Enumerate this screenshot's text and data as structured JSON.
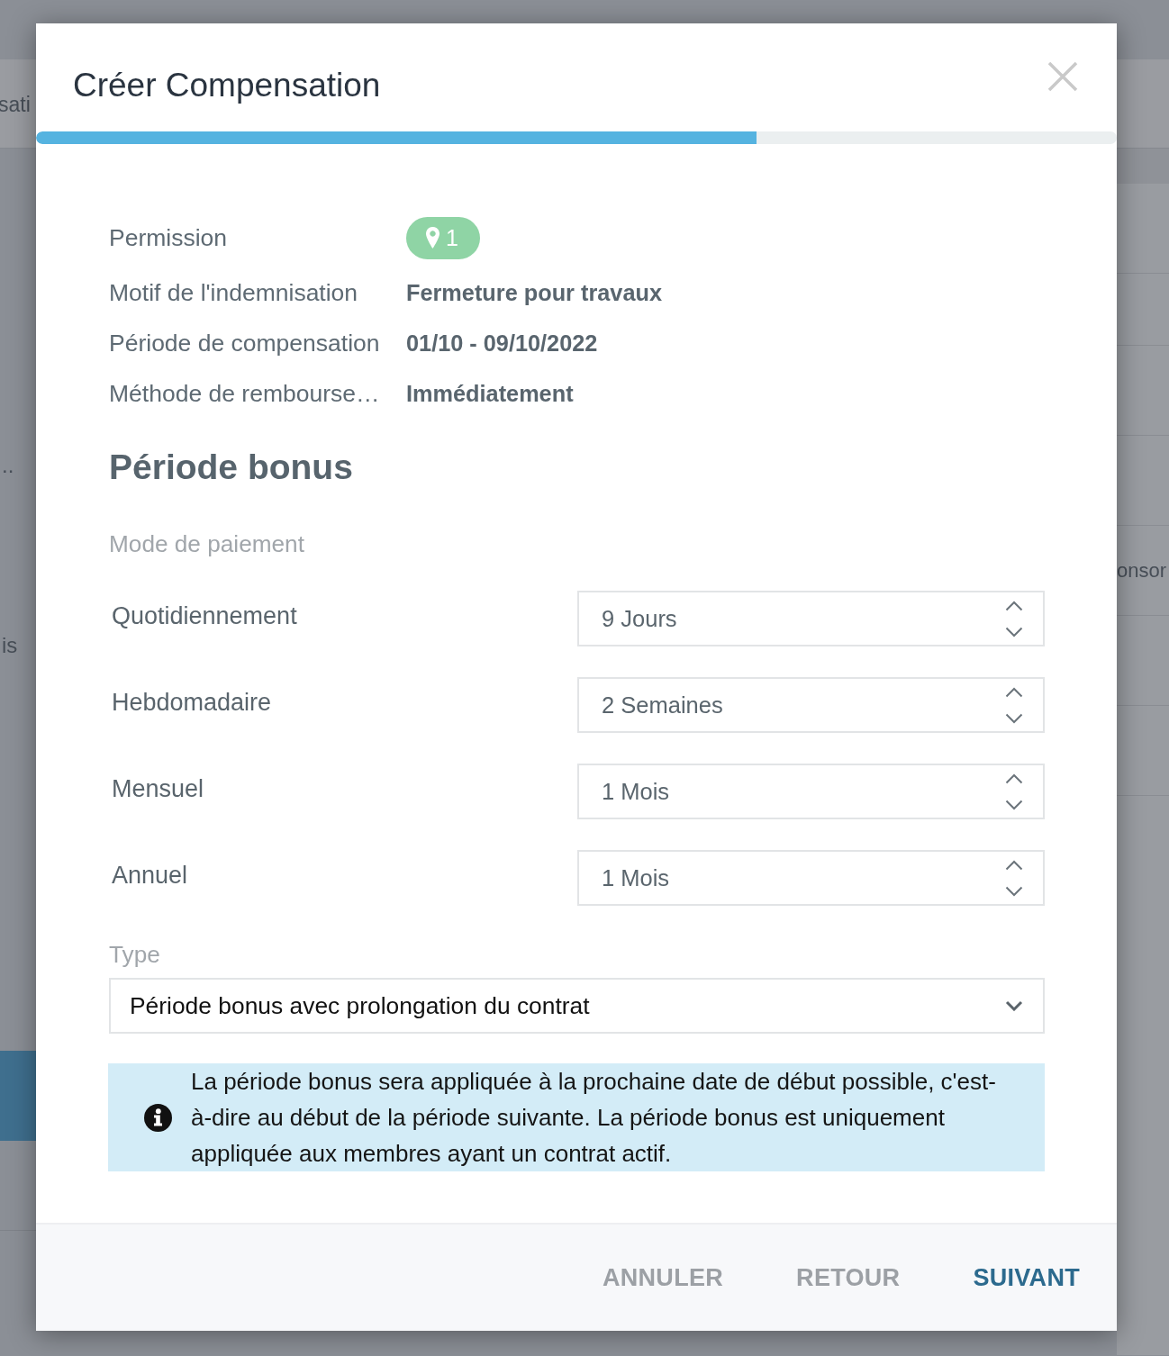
{
  "background": {
    "header_text": "sati",
    "left_rows": [
      {
        "selected": false
      },
      {
        "selected": false
      },
      {
        "selected": false
      },
      {
        "text": "..",
        "selected": false
      },
      {
        "selected": false
      },
      {
        "text": "is",
        "selected": false
      },
      {
        "selected": false
      },
      {
        "selected": false
      },
      {
        "selected": false
      },
      {
        "selected": false
      },
      {
        "selected": true
      },
      {
        "selected": false
      }
    ],
    "right_rows": [
      {
        "selected": false
      },
      {
        "selected": false
      },
      {
        "selected": false
      },
      {
        "selected": false
      },
      {
        "text": "onsor",
        "selected": false
      },
      {
        "selected": false
      },
      {
        "selected": false
      }
    ]
  },
  "dialog": {
    "title": "Créer Compensation",
    "progress": {
      "level": 0.667
    },
    "summary": [
      {
        "label": "Permission",
        "kind": "badge",
        "value": "1"
      },
      {
        "label": "Motif de l'indemnisation",
        "kind": "text",
        "value": "Fermeture pour travaux"
      },
      {
        "label": "Période de compensation",
        "kind": "text",
        "value": "01/10 - 09/10/2022"
      },
      {
        "label": "Méthode de rembourse…",
        "kind": "text",
        "value": "Immédiatement"
      }
    ],
    "section_title": "Période bonus",
    "payment_label": "Mode de paiement",
    "payment_modes": [
      {
        "label": "Quotidiennement",
        "value": "9 Jours"
      },
      {
        "label": "Hebdomadaire",
        "value": "2 Semaines"
      },
      {
        "label": "Mensuel",
        "value": "1 Mois"
      },
      {
        "label": "Annuel",
        "value": "1 Mois"
      }
    ],
    "type_field": {
      "label": "Type",
      "value": "Période bonus avec prolongation du contrat"
    },
    "info": "La période bonus sera appliquée à la prochaine date de début possible, c'est-à-dire au début de la période suivante. La période bonus est uniquement appliquée aux membres ayant un contrat actif.",
    "buttons": [
      {
        "label": "ANNULER",
        "kind": "secondary"
      },
      {
        "label": "RETOUR",
        "kind": "secondary"
      },
      {
        "label": "SUIVANT",
        "kind": "primary"
      }
    ]
  }
}
